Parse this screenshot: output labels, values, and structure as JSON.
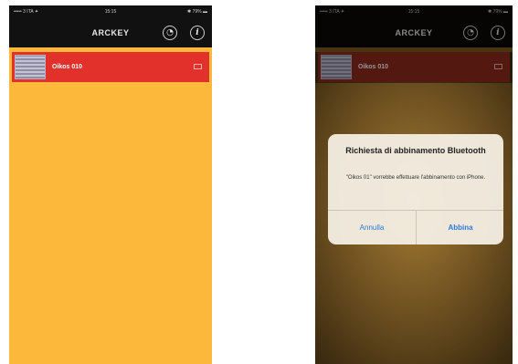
{
  "left_screen": {
    "status": {
      "carrier": "••••• 3 ITA ✦",
      "time": "15:15",
      "battery": "✱ 79% ▬"
    },
    "navbar": {
      "title": "ARCKEY",
      "signal_icon": "antenna-signal-icon",
      "info_icon": "info-icon",
      "info_glyph": "i",
      "signal_glyph": "◔"
    },
    "devices": [
      {
        "name": "Oikos 010",
        "icon": "device-thumbnail",
        "status_icon": "battery-icon"
      }
    ],
    "colors": {
      "background": "#fbb83a",
      "row": "#e2312a",
      "bar": "#111111"
    }
  },
  "right_screen": {
    "status": {
      "carrier": "••••• 3 ITA ✦",
      "time": "15:15",
      "battery": "✱ 79% ▬"
    },
    "navbar": {
      "title": "ARCKEY",
      "signal_glyph": "◔",
      "info_glyph": "i"
    },
    "devices": [
      {
        "name": "Oikos 010"
      }
    ],
    "alert": {
      "title": "Richiesta di abbinamento Bluetooth",
      "message": "\"Oikos 01\" vorrebbe effettuare l'abbinamento con iPhone.",
      "cancel_label": "Annulla",
      "confirm_label": "Abbina",
      "accent": "#2f79d8"
    }
  }
}
